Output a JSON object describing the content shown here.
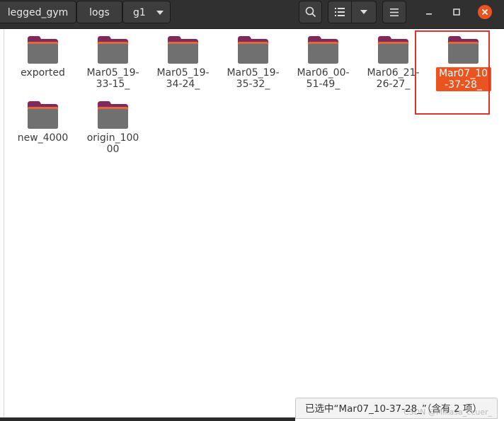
{
  "breadcrumbs": [
    "legged_gym",
    "logs",
    "g1"
  ],
  "toolbar": {
    "search_icon": "search-icon",
    "view_icon": "list-view-icon",
    "menu_icon": "hamburger-menu-icon"
  },
  "window": {
    "minimize_icon": "minimize-icon",
    "maximize_icon": "maximize-icon",
    "close_icon": "close-icon",
    "close_color": "#e95420"
  },
  "folders": [
    {
      "name": "exported",
      "selected": false
    },
    {
      "name": "Mar05_19-33-15_",
      "selected": false
    },
    {
      "name": "Mar05_19-34-24_",
      "selected": false
    },
    {
      "name": "Mar05_19-35-32_",
      "selected": false
    },
    {
      "name": "Mar06_00-51-49_",
      "selected": false
    },
    {
      "name": "Mar06_21-26-27_",
      "selected": false
    },
    {
      "name": "Mar07_10-37-28_",
      "selected": true
    },
    {
      "name": "new_4000",
      "selected": false
    },
    {
      "name": "origin_10000",
      "selected": false
    }
  ],
  "status": {
    "text": "已选中“Mar07_10-37-28_”（含有 2 项）"
  },
  "watermark": "CSDN @Mikasa_ccuer_",
  "colors": {
    "selection": "#e95420",
    "headerbar": "#303030",
    "highlight_box": "#e0312d"
  }
}
